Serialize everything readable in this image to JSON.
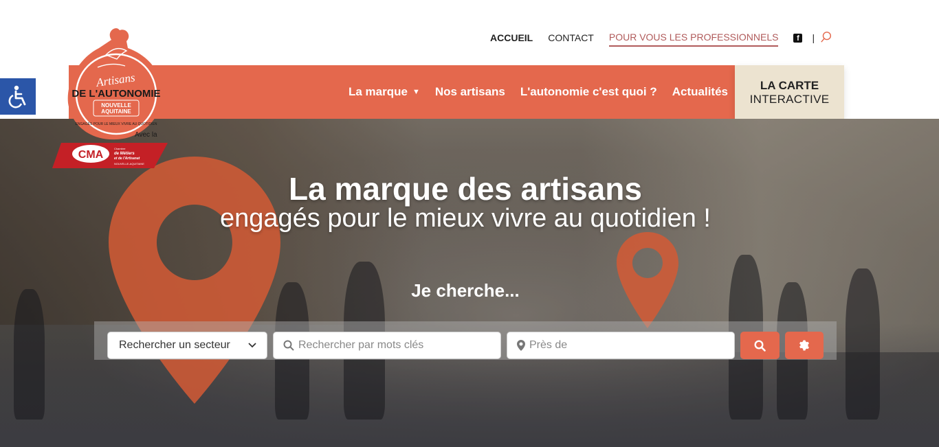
{
  "topnav": {
    "accueil": "ACCUEIL",
    "contact": "CONTACT",
    "pro": "POUR VOUS LES PROFESSIONNELS",
    "facebook_icon": "facebook-icon",
    "separator": "|",
    "search_icon": "search-icon"
  },
  "logo": {
    "line1": "Artisans",
    "line2": "DE L'AUTONOMIE",
    "line3": "NOUVELLE",
    "line4": "AQUITAINE",
    "tagline": "ENGAGÉS POUR LE MIEUX VIVRE AU QUOTIDIEN",
    "with": "Avec la",
    "cma_initials": "CMA",
    "cma_line1": "Chambre",
    "cma_line2": "de Métiers",
    "cma_line3": "et de l'Artisanat",
    "cma_region": "NOUVELLE-AQUITAINE"
  },
  "mainnav": {
    "items": [
      {
        "label": "La marque",
        "chevron": "⌄"
      },
      {
        "label": "Nos artisans"
      },
      {
        "label": "L'autonomie c'est quoi ?"
      },
      {
        "label": "Actualités"
      }
    ],
    "carte_line1": "LA CARTE",
    "carte_line2": "INTERACTIVE"
  },
  "hero": {
    "title": "La marque des artisans",
    "subtitle": "engagés pour le mieux vivre au quotidien !",
    "search_heading": "Je cherche..."
  },
  "search": {
    "sector_select": "Rechercher un secteur",
    "keywords_placeholder": "Rechercher par mots clés",
    "location_placeholder": "Près de"
  },
  "colors": {
    "accent": "#e4684d",
    "carte_bg": "#ece3d0",
    "a11y": "#2b56a8",
    "pro_link": "#b05a5a"
  }
}
